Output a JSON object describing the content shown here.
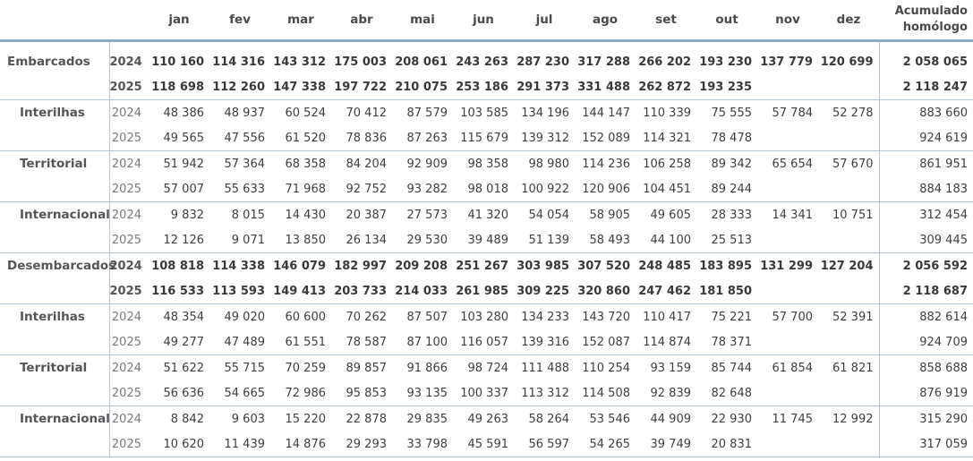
{
  "header": {
    "months": [
      "jan",
      "fev",
      "mar",
      "abr",
      "mai",
      "jun",
      "jul",
      "ago",
      "set",
      "out",
      "nov",
      "dez"
    ],
    "acc_line1": "Acumulado",
    "acc_line2": "homólogo"
  },
  "rows": [
    {
      "category": "Embarcados",
      "level": "top",
      "year": "2024",
      "values": [
        "110 160",
        "114 316",
        "143 312",
        "175 003",
        "208 061",
        "243 263",
        "287 230",
        "317 288",
        "266 202",
        "193 230",
        "137 779",
        "120 699"
      ],
      "total": "2 058 065"
    },
    {
      "category": "",
      "level": "top",
      "year": "2025",
      "values": [
        "118 698",
        "112 260",
        "147 338",
        "197 722",
        "210 075",
        "253 186",
        "291 373",
        "331 488",
        "262 872",
        "193 235",
        "",
        ""
      ],
      "total": "2 118 247"
    },
    {
      "category": "Interilhas",
      "level": "sub",
      "year": "2024",
      "values": [
        "48 386",
        "48 937",
        "60 524",
        "70 412",
        "87 579",
        "103 585",
        "134 196",
        "144 147",
        "110 339",
        "75 555",
        "57 784",
        "52 278"
      ],
      "total": "883 660"
    },
    {
      "category": "",
      "level": "sub",
      "year": "2025",
      "values": [
        "49 565",
        "47 556",
        "61 520",
        "78 836",
        "87 263",
        "115 679",
        "139 312",
        "152 089",
        "114 321",
        "78 478",
        "",
        ""
      ],
      "total": "924 619"
    },
    {
      "category": "Territorial",
      "level": "sub",
      "year": "2024",
      "values": [
        "51 942",
        "57 364",
        "68 358",
        "84 204",
        "92 909",
        "98 358",
        "98 980",
        "114 236",
        "106 258",
        "89 342",
        "65 654",
        "57 670"
      ],
      "total": "861 951"
    },
    {
      "category": "",
      "level": "sub",
      "year": "2025",
      "values": [
        "57 007",
        "55 633",
        "71 968",
        "92 752",
        "93 282",
        "98 018",
        "100 922",
        "120 906",
        "104 451",
        "89 244",
        "",
        ""
      ],
      "total": "884 183"
    },
    {
      "category": "Internacional",
      "level": "sub",
      "year": "2024",
      "values": [
        "9 832",
        "8 015",
        "14 430",
        "20 387",
        "27 573",
        "41 320",
        "54 054",
        "58 905",
        "49 605",
        "28 333",
        "14 341",
        "10 751"
      ],
      "total": "312 454"
    },
    {
      "category": "",
      "level": "sub",
      "year": "2025",
      "values": [
        "12 126",
        "9 071",
        "13 850",
        "26 134",
        "29 530",
        "39 489",
        "51 139",
        "58 493",
        "44 100",
        "25 513",
        "",
        ""
      ],
      "total": "309 445"
    },
    {
      "category": "Desembarcados",
      "level": "top",
      "year": "2024",
      "values": [
        "108 818",
        "114 338",
        "146 079",
        "182 997",
        "209 208",
        "251 267",
        "303 985",
        "307 520",
        "248 485",
        "183 895",
        "131 299",
        "127 204"
      ],
      "total": "2 056 592"
    },
    {
      "category": "",
      "level": "top",
      "year": "2025",
      "values": [
        "116 533",
        "113 593",
        "149 413",
        "203 733",
        "214 033",
        "261 985",
        "309 225",
        "320 860",
        "247 462",
        "181 850",
        "",
        ""
      ],
      "total": "2 118 687"
    },
    {
      "category": "Interilhas",
      "level": "sub",
      "year": "2024",
      "values": [
        "48 354",
        "49 020",
        "60 600",
        "70 262",
        "87 507",
        "103 280",
        "134 233",
        "143 720",
        "110 417",
        "75 221",
        "57 700",
        "52 391"
      ],
      "total": "882 614"
    },
    {
      "category": "",
      "level": "sub",
      "year": "2025",
      "values": [
        "49 277",
        "47 489",
        "61 551",
        "78 587",
        "87 100",
        "116 057",
        "139 316",
        "152 087",
        "114 874",
        "78 371",
        "",
        ""
      ],
      "total": "924 709"
    },
    {
      "category": "Territorial",
      "level": "sub",
      "year": "2024",
      "values": [
        "51 622",
        "55 715",
        "70 259",
        "89 857",
        "91 866",
        "98 724",
        "111 488",
        "110 254",
        "93 159",
        "85 744",
        "61 854",
        "61 821"
      ],
      "total": "858 688"
    },
    {
      "category": "",
      "level": "sub",
      "year": "2025",
      "values": [
        "56 636",
        "54 665",
        "72 986",
        "95 853",
        "93 135",
        "100 337",
        "113 312",
        "114 508",
        "92 839",
        "82 648",
        "",
        ""
      ],
      "total": "876 919"
    },
    {
      "category": "Internacional",
      "level": "sub",
      "year": "2024",
      "values": [
        "8 842",
        "9 603",
        "15 220",
        "22 878",
        "29 835",
        "49 263",
        "58 264",
        "53 546",
        "44 909",
        "22 930",
        "11 745",
        "12 992"
      ],
      "total": "315 290"
    },
    {
      "category": "",
      "level": "sub",
      "year": "2025",
      "values": [
        "10 620",
        "11 439",
        "14 876",
        "29 293",
        "33 798",
        "45 591",
        "56 597",
        "54 265",
        "39 749",
        "20 831",
        "",
        ""
      ],
      "total": "317 059"
    }
  ]
}
